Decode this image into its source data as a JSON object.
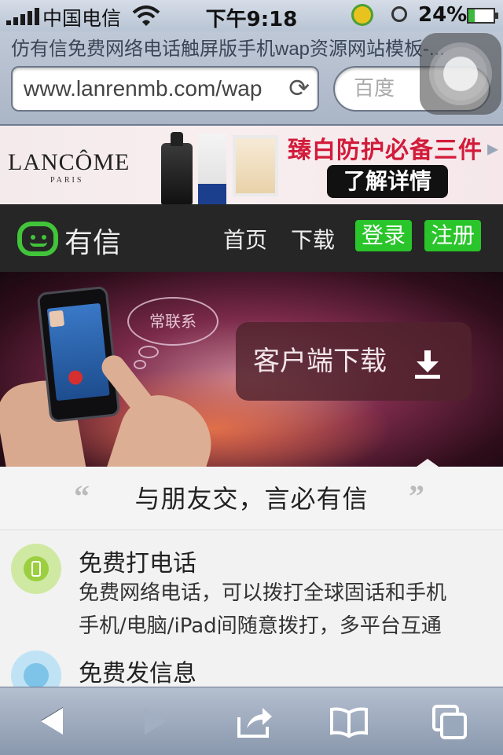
{
  "status_bar": {
    "carrier": "中国电信",
    "time": "下午9:18",
    "battery_percent": "24%",
    "battery_level": 0.24
  },
  "browser": {
    "page_title": "仿有信免费网络电话触屏版手机wap资源网站模板-...",
    "url": "www.lanrenmb.com/wap",
    "search_placeholder": "百度"
  },
  "ad": {
    "brand": "LANCÔME",
    "brand_sub": "PARIS",
    "slogan": "臻白防护必备三件",
    "cta": "了解详情"
  },
  "nav": {
    "logo_text": "有信",
    "links": [
      "首页",
      "下载"
    ],
    "login": "登录",
    "register": "注册",
    "accent": "#29c52a"
  },
  "hero": {
    "bubble_text": "常联系",
    "download_label": "客户端下载"
  },
  "content": {
    "quote_open": "“",
    "quote_close": "”",
    "tagline": "与朋友交，言必有信",
    "features": [
      {
        "title": "免费打电话",
        "lines": [
          "免费网络电话，可以拨打全球固话和手机",
          "手机/电脑/iPad间随意拨打，多平台互通"
        ],
        "icon": "phone-icon"
      },
      {
        "title": "免费发信息",
        "lines": [],
        "icon": "message-icon"
      }
    ]
  }
}
